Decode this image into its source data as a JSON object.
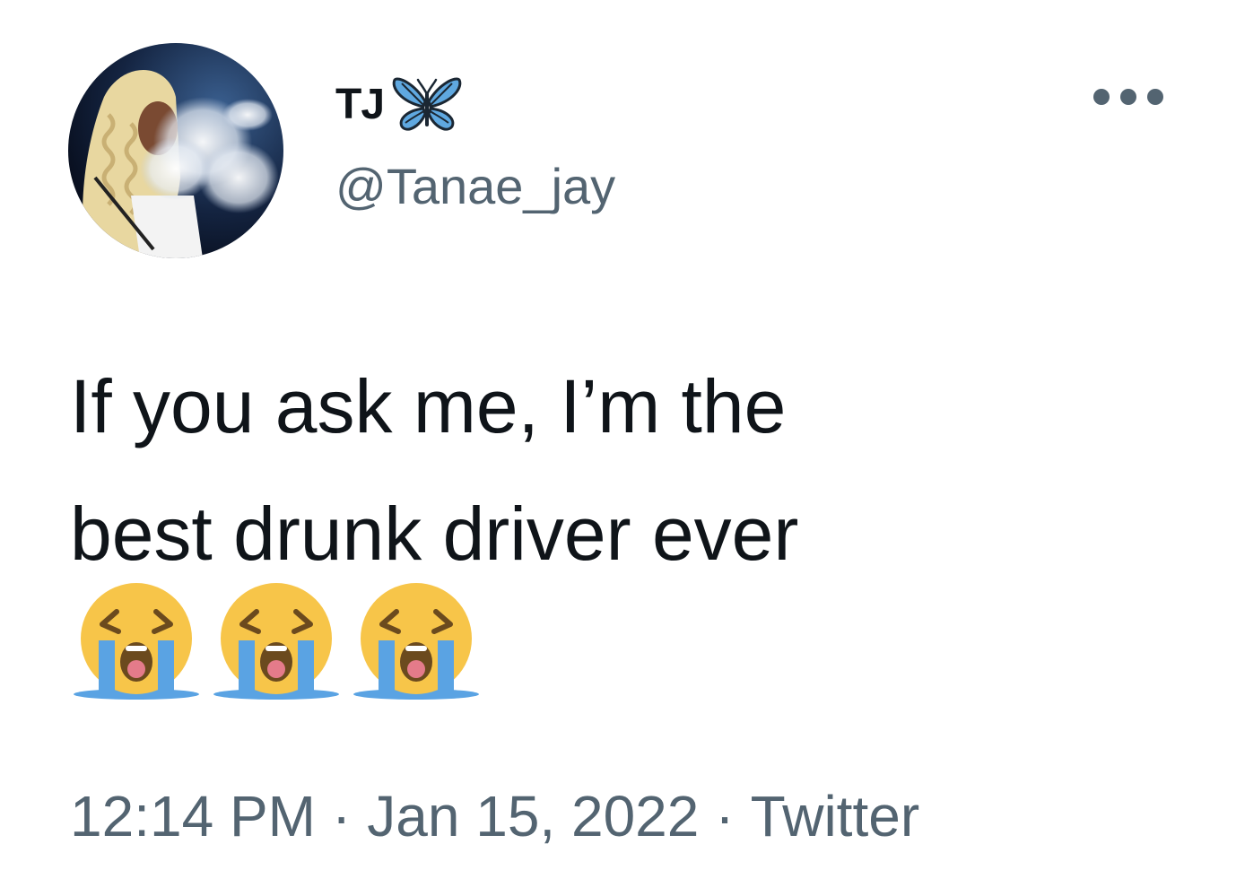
{
  "author": {
    "display_name": "TJ",
    "display_name_emoji": "butterfly-icon",
    "handle": "@Tanae_jay"
  },
  "tweet": {
    "text_line_1": "If you ask me, I’m the",
    "text_line_2": "best drunk driver ever",
    "emojis": [
      "loudly-crying-face-icon",
      "loudly-crying-face-icon",
      "loudly-crying-face-icon"
    ]
  },
  "meta": {
    "time": "12:14 PM",
    "separator": "·",
    "date": "Jan 15, 2022",
    "source": "Twitter"
  },
  "colors": {
    "text_primary": "#0f1419",
    "text_secondary": "#536471",
    "background": "#ffffff",
    "butterfly_blue": "#5fa8e0",
    "emoji_yellow": "#f7c549",
    "emoji_tears": "#5aa3e3"
  }
}
